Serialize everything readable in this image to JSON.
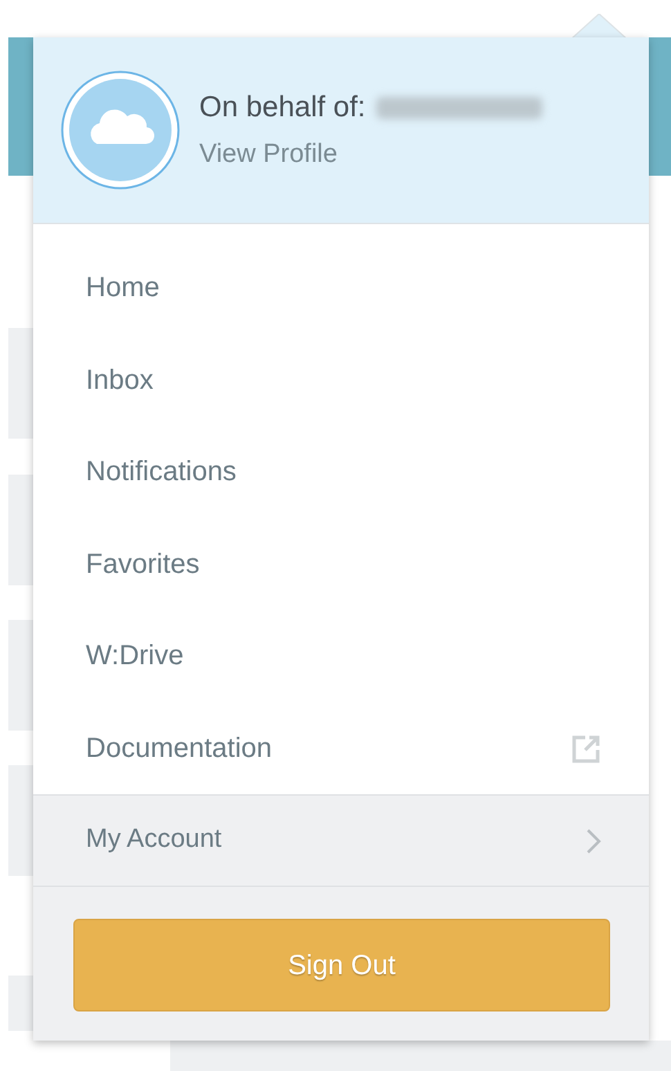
{
  "profile": {
    "label": "On behalf of:",
    "link": "View Profile"
  },
  "menu": [
    {
      "label": "Home",
      "kind": "link"
    },
    {
      "label": "Inbox",
      "kind": "link"
    },
    {
      "label": "Notifications",
      "kind": "link"
    },
    {
      "label": "Favorites",
      "kind": "link"
    },
    {
      "label": "W:Drive",
      "kind": "link"
    },
    {
      "label": "Documentation",
      "kind": "external"
    }
  ],
  "account": {
    "label": "My Account",
    "kind": "submenu"
  },
  "sign_out": "Sign Out"
}
